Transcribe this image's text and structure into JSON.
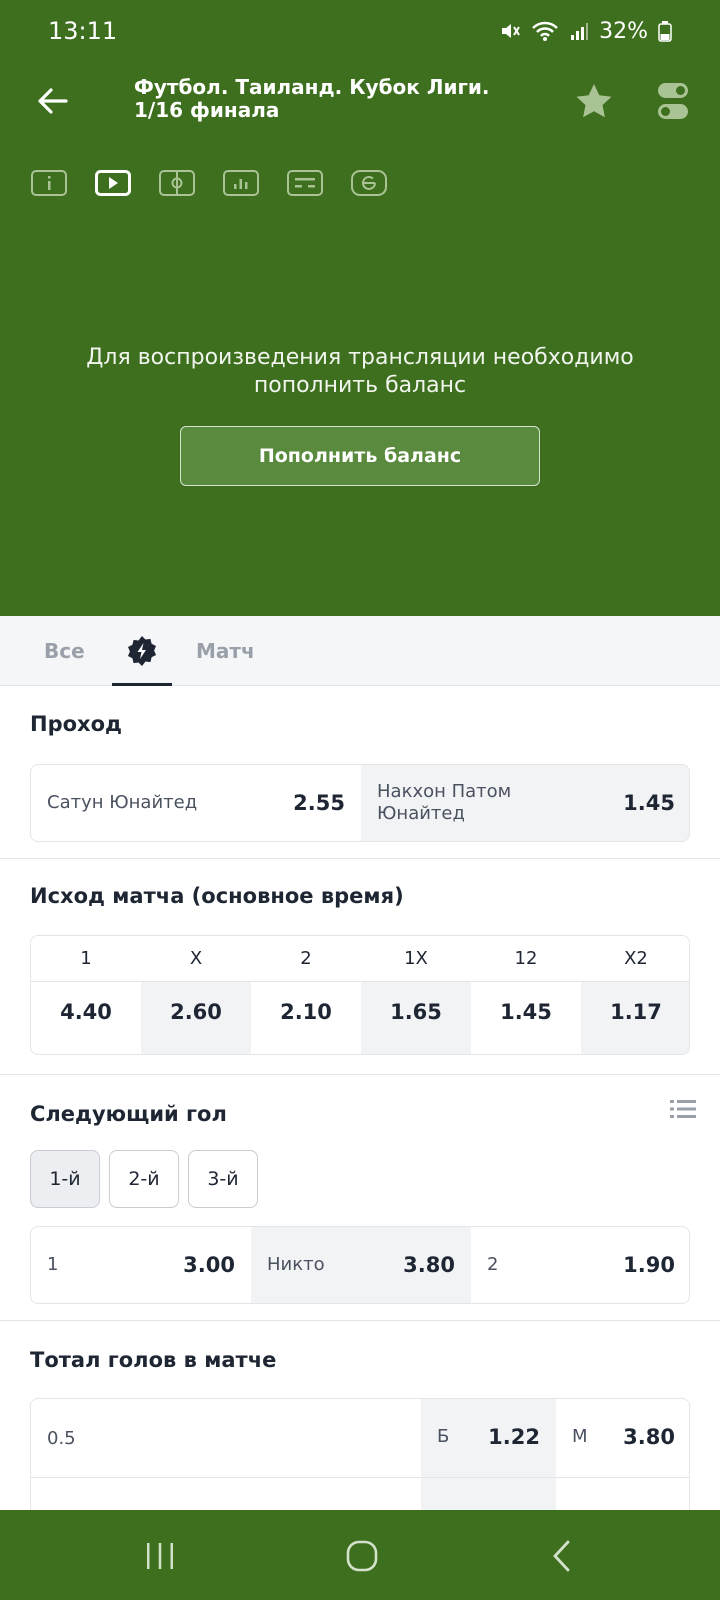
{
  "status_bar": {
    "time": "13:11",
    "battery": "32%"
  },
  "header": {
    "title": "Футбол. Таиланд. Кубок Лиги. 1/16 финала",
    "icons": [
      "info-icon",
      "video-icon",
      "pitch-icon",
      "stats-icon",
      "scoreboard-icon",
      "feed-icon"
    ],
    "message": "Для воспроизведения трансляции необходимо пополнить баланс",
    "topup_label": "Пополнить баланс"
  },
  "tabs": {
    "all": "Все",
    "match": "Матч",
    "active": "lightning"
  },
  "qualify": {
    "title": "Проход",
    "team1": "Сатун Юнайтед",
    "odd1": "2.55",
    "team2": "Накхон Патом Юнайтед",
    "odd2": "1.45"
  },
  "result": {
    "title": "Исход матча (основное время)",
    "headers": [
      "1",
      "X",
      "2",
      "1X",
      "12",
      "X2"
    ],
    "odds": [
      "4.40",
      "2.60",
      "2.10",
      "1.65",
      "1.45",
      "1.17"
    ]
  },
  "next_goal": {
    "title": "Следующий гол",
    "options": [
      "1-й",
      "2-й",
      "3-й"
    ],
    "selected": "1-й",
    "outcomes": [
      {
        "label": "1",
        "odd": "3.00"
      },
      {
        "label": "Никто",
        "odd": "3.80"
      },
      {
        "label": "2",
        "odd": "1.90"
      }
    ]
  },
  "totals": {
    "title": "Тотал голов в матче",
    "rows": [
      {
        "line": "0.5",
        "over_label": "Б",
        "over": "1.22",
        "under_label": "М",
        "under": "3.80"
      }
    ]
  },
  "colors": {
    "brand_green": "#3d6f1e",
    "text_dark": "#1f2633",
    "muted": "#9aa0aa"
  }
}
